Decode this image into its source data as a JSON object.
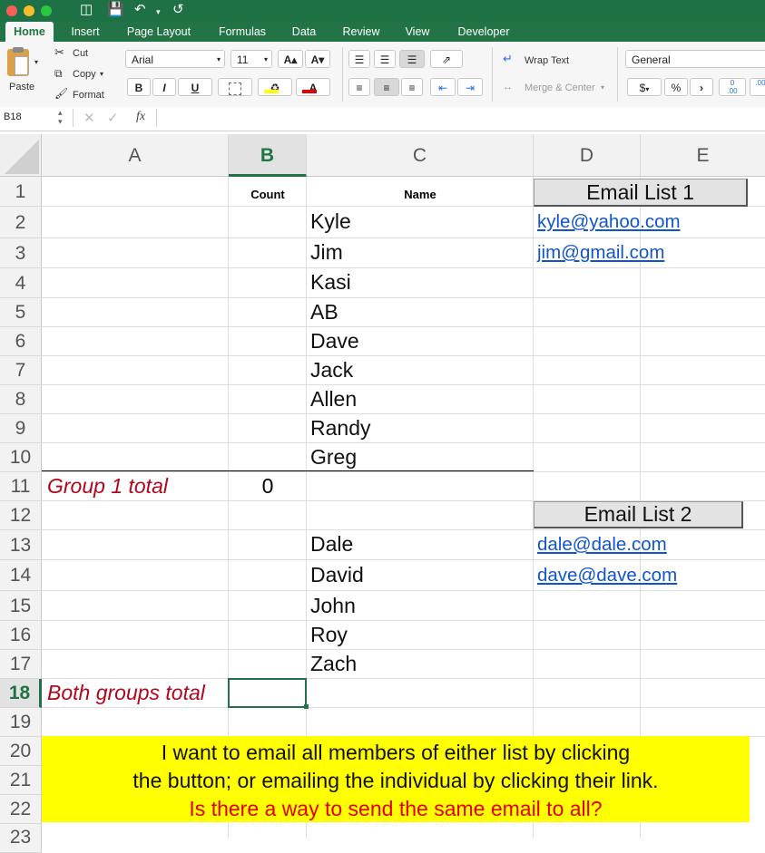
{
  "window": {
    "traffic_lights": [
      "#fc5f57",
      "#fdbc2e",
      "#28c840"
    ]
  },
  "tabs": [
    {
      "label": "Home",
      "active": true
    },
    {
      "label": "Insert"
    },
    {
      "label": "Page Layout"
    },
    {
      "label": "Formulas"
    },
    {
      "label": "Data"
    },
    {
      "label": "Review"
    },
    {
      "label": "View"
    },
    {
      "label": "Developer"
    }
  ],
  "ribbon": {
    "paste": "Paste",
    "cut": "Cut",
    "copy": "Copy",
    "format": "Format",
    "font_name": "Arial",
    "font_size": "11",
    "bold": "B",
    "italic": "I",
    "underline": "U",
    "wrap_text": "Wrap Text",
    "merge_center": "Merge & Center",
    "number_format": "General",
    "currency": "$",
    "percent": "%",
    "comma": "›",
    "inc_decimal": "0",
    "dec_decimal": "00"
  },
  "formula_bar": {
    "name_box": "B18",
    "fx": "fx",
    "value": ""
  },
  "columns": [
    "A",
    "B",
    "C",
    "D",
    "E"
  ],
  "rows": [
    "1",
    "2",
    "3",
    "4",
    "5",
    "6",
    "7",
    "8",
    "9",
    "10",
    "11",
    "12",
    "13",
    "14",
    "15",
    "16",
    "17",
    "18",
    "19",
    "20",
    "21",
    "22",
    "23"
  ],
  "selected_cell": "B18",
  "sheet": {
    "b1": "Count",
    "c1": "Name",
    "group1_names": [
      "Kyle",
      "Jim",
      "Kasi",
      "AB",
      "Dave",
      "Jack",
      "Allen",
      "Randy",
      "Greg"
    ],
    "group1_label": "Group 1 total",
    "group1_count": "0",
    "group2_names": [
      "Dale",
      "David",
      "John",
      "Roy",
      "Zach"
    ],
    "both_label": "Both groups total",
    "email_list1_button": "Email List 1",
    "email_list1": [
      "kyle@yahoo.com",
      "jim@gmail.com"
    ],
    "email_list2_button": "Email List 2",
    "email_list2": [
      "dale@dale.com",
      "dave@dave.com"
    ],
    "note_line1": "I want to email all members of either list  by clicking",
    "note_line2": "the button; or emailing the individual by clicking their link.",
    "note_line3": "Is there a way to send the same email to all?"
  },
  "colors": {
    "excel_green": "#217346",
    "group_label": "#b1061c",
    "note_question": "#e00000",
    "note_bg": "#ffff00",
    "link": "#1155cc"
  }
}
